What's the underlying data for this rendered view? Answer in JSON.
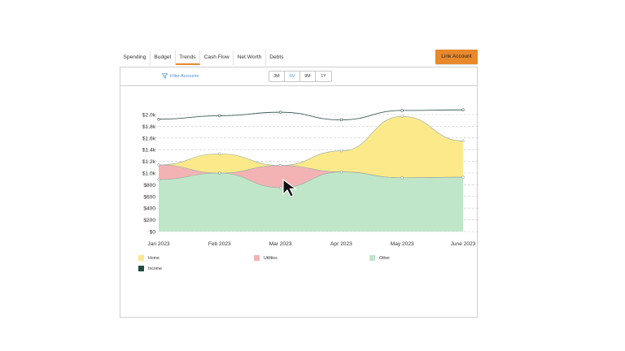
{
  "tabs": [
    {
      "label": "Spending",
      "active": false
    },
    {
      "label": "Budget",
      "active": false
    },
    {
      "label": "Trends",
      "active": true
    },
    {
      "label": "Cash Flow",
      "active": false
    },
    {
      "label": "Net Worth",
      "active": false
    },
    {
      "label": "Debts",
      "active": false
    }
  ],
  "link_account_label": "Link Account",
  "filter_label": "Filter Accounts",
  "ranges": [
    {
      "label": "3M",
      "active": false
    },
    {
      "label": "6M",
      "active": true
    },
    {
      "label": "9M",
      "active": false
    },
    {
      "label": "1Y",
      "active": false
    }
  ],
  "legend": {
    "home": "Home",
    "utilities": "Utilities",
    "other": "Other",
    "income": "Income"
  },
  "colors": {
    "accent": "#e8892c",
    "home": "#fbe98a",
    "utilities": "#f3b3b5",
    "other": "#bfe6c8",
    "income": "#1f4d46"
  },
  "icons": {
    "filter": "filter-icon",
    "cursor": "mouse-pointer-icon"
  },
  "chart_data": {
    "type": "area",
    "categories": [
      "Jan 2023",
      "Feb 2023",
      "Mar 2023",
      "Apr 2023",
      "May 2023",
      "June 2023"
    ],
    "y_tick_labels": [
      "$0",
      "$200",
      "$400",
      "$600",
      "$800",
      "$1.0k",
      "$1.2k",
      "$1.4k",
      "$1.6k",
      "$1.8k",
      "$2.0k"
    ],
    "ylim": [
      0,
      2100
    ],
    "stacked": true,
    "series": [
      {
        "name": "Other",
        "kind": "area",
        "values": [
          890,
          1000,
          750,
          1020,
          920,
          930
        ]
      },
      {
        "name": "Utilities",
        "kind": "area",
        "values": [
          250,
          0,
          380,
          0,
          0,
          0
        ]
      },
      {
        "name": "Home",
        "kind": "area",
        "values": [
          0,
          330,
          0,
          360,
          1050,
          620
        ]
      },
      {
        "name": "Income",
        "kind": "line",
        "values": [
          1920,
          1980,
          2040,
          1910,
          2070,
          2080
        ]
      }
    ],
    "grid": true,
    "legend_position": "bottom"
  }
}
